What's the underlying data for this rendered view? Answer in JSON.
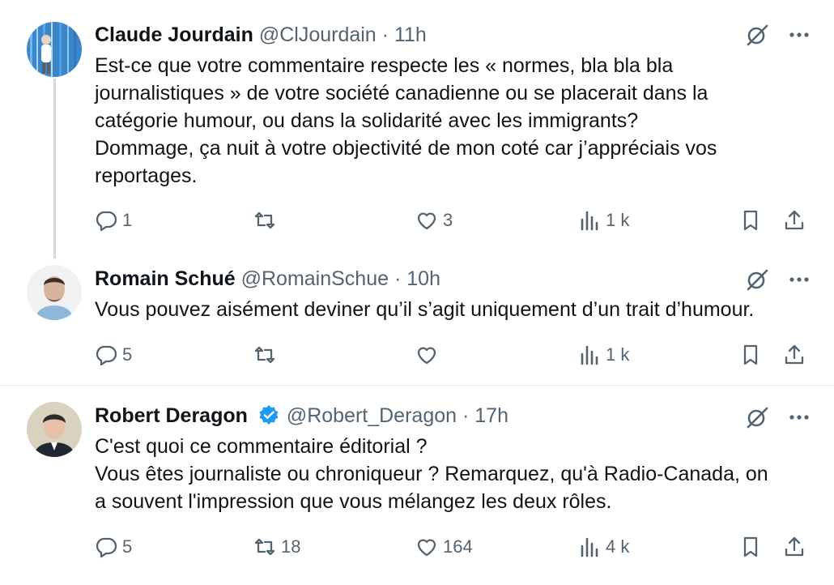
{
  "tweets": [
    {
      "author": "Claude Jourdain",
      "handle": "@ClJourdain",
      "separator": "·",
      "time": "11h",
      "verified": false,
      "lines": [
        "Est-ce que votre commentaire respecte les « normes, bla bla bla",
        "journalistiques » de votre société canadienne ou se placerait dans la",
        "catégorie humour, ou dans la solidarité avec les immigrants?",
        "Dommage, ça nuit à votre objectivité de mon coté car j’appréciais vos",
        "reportages."
      ],
      "replies": "1",
      "reposts": "",
      "likes": "3",
      "views": "1 k"
    },
    {
      "author": "Romain Schué",
      "handle": "@RomainSchue",
      "separator": "·",
      "time": "10h",
      "verified": false,
      "lines": [
        "Vous pouvez aisément deviner qu’il s’agit uniquement d’un trait d’humour."
      ],
      "replies": "5",
      "reposts": "",
      "likes": "",
      "views": "1 k"
    },
    {
      "author": "Robert Deragon",
      "handle": "@Robert_Deragon",
      "separator": "·",
      "time": "17h",
      "verified": true,
      "lines": [
        "C'est quoi ce commentaire éditorial ?",
        "Vous êtes journaliste ou chroniqueur ? Remarquez, qu'à Radio-Canada, on",
        "a souvent l'impression que vous mélangez les deux rôles."
      ],
      "replies": "5",
      "reposts": "18",
      "likes": "164",
      "views": "4 k"
    }
  ],
  "icons": {
    "reply": "reply-icon",
    "repost": "repost-icon",
    "like": "like-icon",
    "views": "views-icon",
    "bookmark": "bookmark-icon",
    "share": "share-icon",
    "grok": "grok-icon",
    "more": "more-icon",
    "verified": "verified-badge-icon"
  },
  "colors": {
    "text": "#0f1419",
    "secondary": "#536471",
    "verified": "#1d9bf0",
    "thread_line": "#cfd9de",
    "divider": "#eff3f4"
  }
}
